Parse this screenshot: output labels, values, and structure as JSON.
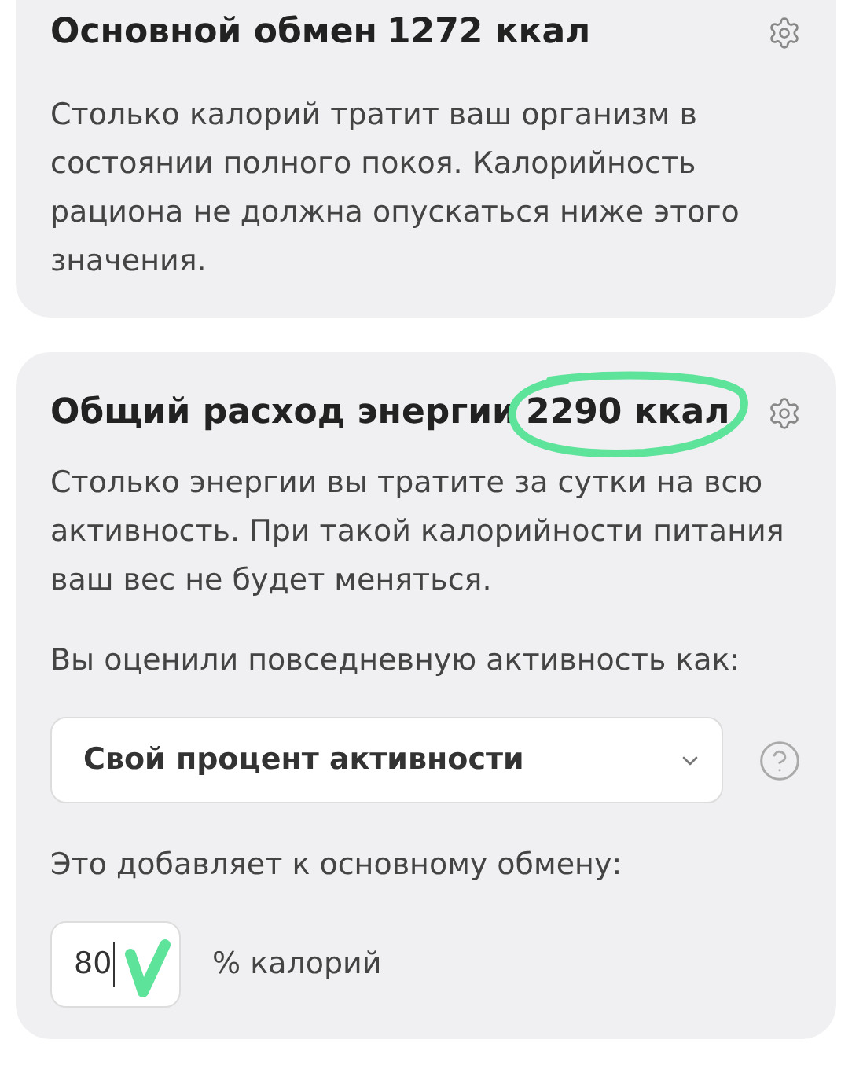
{
  "cards": [
    {
      "title": "Основной обмен",
      "value": "1272 ккал",
      "highlighted": false,
      "description": "Столько калорий тратит ваш организм в состоянии полного покоя. Калорийность рациона не должна опускаться ниже этого значения."
    },
    {
      "title": "Общий расход энергии",
      "value": "2290 ккал",
      "highlighted": true,
      "description": "Столько энергии вы тратите за сутки на всю активность. При такой калорийности питания ваш вес не будет меняться.",
      "activity_label": "Вы оценили повседневную активность как:",
      "select": {
        "value": "Свой процент активности"
      },
      "addition_label": "Это добавляет к основному обмену:",
      "percent_field": {
        "value": "80",
        "ticked": true
      },
      "unit": "% калорий"
    }
  ]
}
